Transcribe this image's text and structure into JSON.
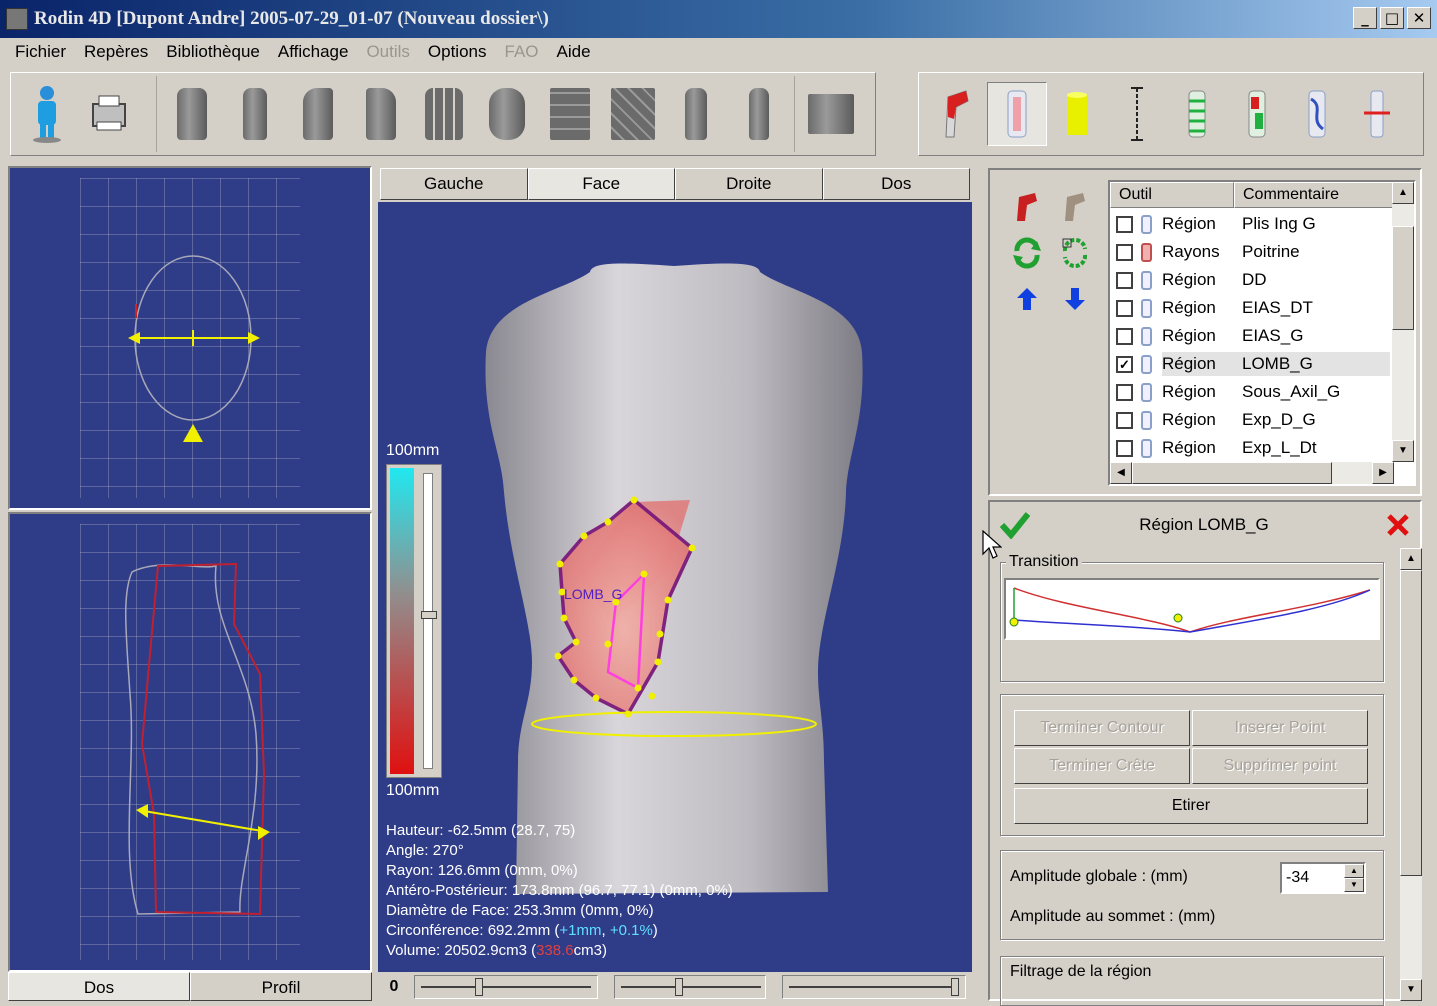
{
  "window": {
    "title": "Rodin 4D [Dupont Andre] 2005-07-29_01-07 (Nouveau dossier\\)",
    "minimize": "_",
    "maximize": "□",
    "close": "✕"
  },
  "menu": [
    {
      "label": "Fichier",
      "enabled": true
    },
    {
      "label": "Repères",
      "enabled": true
    },
    {
      "label": "Bibliothèque",
      "enabled": true
    },
    {
      "label": "Affichage",
      "enabled": true
    },
    {
      "label": "Outils",
      "enabled": false
    },
    {
      "label": "Options",
      "enabled": true
    },
    {
      "label": "FAO",
      "enabled": false
    },
    {
      "label": "Aide",
      "enabled": true
    }
  ],
  "toolbar_icons": [
    "person-icon",
    "printer-icon",
    "shape-front-icon",
    "shape-back-icon",
    "shape-side-icon",
    "shape-side2-icon",
    "shape-split-icon",
    "shape-rotate-icon",
    "shape-pieces-icon",
    "shape-pieces2-icon",
    "shape-narrow-icon",
    "shape-narrow2-icon",
    "shape-base-icon",
    "region-tool-icon",
    "band-tool-icon",
    "cylinder-tool-icon",
    "measure-tool-icon",
    "ring-tool-icon",
    "marker-tool-icon",
    "twist-tool-icon",
    "cut-tool-icon"
  ],
  "left_tabs": [
    "Dos",
    "Profil"
  ],
  "view_tabs": [
    "Gauche",
    "Face",
    "Droite",
    "Dos"
  ],
  "scale": {
    "top": "100mm",
    "bottom": "100mm"
  },
  "region_label": "LOMB_G",
  "info": {
    "hauteur": "Hauteur: -62.5mm (28.7, 75)",
    "angle": "Angle: 270°",
    "rayon": "Rayon: 126.6mm (0mm, 0%)",
    "antero": "Antéro-Postérieur: 173.8mm (96.7, 77.1) (0mm, 0%)",
    "diametre": "Diamètre de Face: 253.3mm (0mm, 0%)",
    "circ_prefix": "Circonférence: 692.2mm (",
    "circ_delta": "+1mm",
    "circ_sep": ", ",
    "circ_pct": "+0.1%",
    "circ_suffix": ")",
    "vol_prefix": "Volume: 20502.9cm3 (",
    "vol_delta": "338.6",
    "vol_suffix": "cm3)"
  },
  "bottom_slider_label": "0",
  "list": {
    "headers": [
      "Outil",
      "Commentaire"
    ],
    "rows": [
      {
        "outil": "Région",
        "commentaire": "Plis Ing G",
        "checked": false,
        "icon": "region-icon"
      },
      {
        "outil": "Rayons",
        "commentaire": "Poitrine",
        "checked": false,
        "icon": "rays-icon"
      },
      {
        "outil": "Région",
        "commentaire": "DD",
        "checked": false,
        "icon": "region-icon"
      },
      {
        "outil": "Région",
        "commentaire": "EIAS_DT",
        "checked": false,
        "icon": "region-icon"
      },
      {
        "outil": "Région",
        "commentaire": "EIAS_G",
        "checked": false,
        "icon": "region-icon"
      },
      {
        "outil": "Région",
        "commentaire": "LOMB_G",
        "checked": true,
        "icon": "region-icon"
      },
      {
        "outil": "Région",
        "commentaire": "Sous_Axil_G",
        "checked": false,
        "icon": "region-icon"
      },
      {
        "outil": "Région",
        "commentaire": "Exp_D_G",
        "checked": false,
        "icon": "region-icon"
      },
      {
        "outil": "Région",
        "commentaire": "Exp_L_Dt",
        "checked": false,
        "icon": "region-icon"
      }
    ]
  },
  "props": {
    "title": "Région LOMB_G",
    "transition_label": "Transition",
    "buttons": {
      "terminer_contour": "Terminer Contour",
      "inserer_point": "Inserer Point",
      "terminer_crete": "Terminer Crête",
      "supprimer_point": "Supprimer point",
      "etirer": "Etirer"
    },
    "amplitude_globale": "Amplitude globale : (mm)",
    "amplitude_value": "-34",
    "amplitude_sommet": "Amplitude au sommet : (mm)",
    "filtrage": "Filtrage de la région"
  }
}
